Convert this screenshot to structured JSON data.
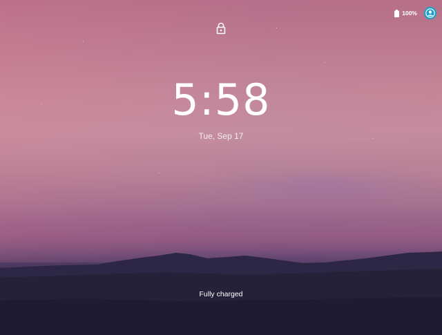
{
  "status_bar": {
    "battery_text": "100%",
    "battery_icon": "battery-full-icon",
    "avatar_icon": "user-avatar-icon",
    "avatar_color": "#1aa0c8"
  },
  "lock": {
    "icon": "lock-icon"
  },
  "clock": {
    "time": "5:58",
    "date": "Tue, Sep 17"
  },
  "charging": {
    "status_text": "Fully charged"
  }
}
